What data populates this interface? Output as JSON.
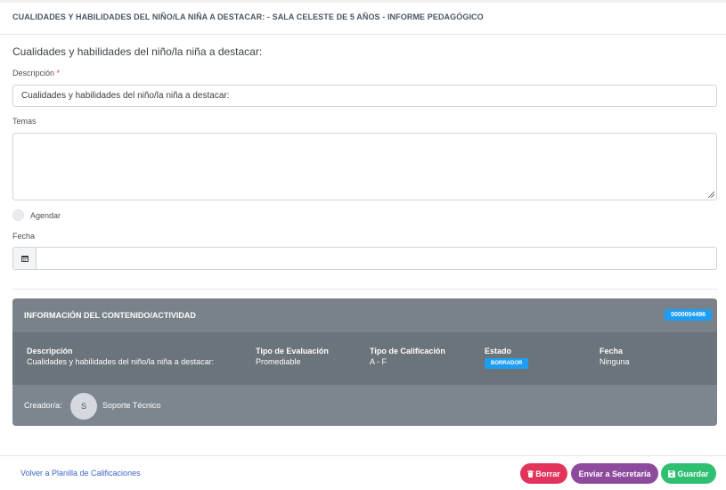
{
  "header": {
    "title": "CUALIDADES Y HABILIDADES DEL NIÑO/LA NIÑA A DESTACAR: - SALA CELESTE DE 5 AÑOS - INFORME PEDAGÓGICO"
  },
  "form": {
    "section_title": "Cualidades y habilidades del niño/la niña a destacar:",
    "descripcion_label": "Descripción",
    "required_mark": "*",
    "descripcion_value": "Cualidades y habilidades del niño/la niña a destacar:",
    "temas_label": "Temas",
    "temas_value": "",
    "agendar_label": "Agendar",
    "fecha_label": "Fecha",
    "fecha_value": ""
  },
  "card": {
    "title": "INFORMACIÓN DEL CONTENIDO/ACTIVIDAD",
    "code": "0000004496",
    "columns": {
      "descripcion": {
        "label": "Descripción",
        "value": "Cualidades y habilidades del niño/la niña a destacar:"
      },
      "tipo_evaluacion": {
        "label": "Tipo de Evaluación",
        "value": "Promediable"
      },
      "tipo_calificacion": {
        "label": "Tipo de Calificación",
        "value": "A - F"
      },
      "estado": {
        "label": "Estado",
        "value": "BORRADOR",
        "color": "#1e9ef2"
      },
      "fecha": {
        "label": "Fecha",
        "value": "Ninguna"
      }
    },
    "creator_label": "Creador/a:",
    "creator_initial": "S",
    "creator_name": "Soporte Técnico"
  },
  "footer": {
    "back_link": "Volver a Planilla de Calificaciones",
    "borrar_label": "Borrar",
    "enviar_label": "Enviar a Secretaría",
    "guardar_label": "Guardar"
  },
  "colors": {
    "borrar": "#e2345a",
    "enviar": "#8e4b9e",
    "guardar": "#2fbf71",
    "badge": "#1e9ef2"
  },
  "icons": {
    "calendar": "calendar-icon",
    "trash": "trash-icon",
    "save": "save-icon"
  }
}
